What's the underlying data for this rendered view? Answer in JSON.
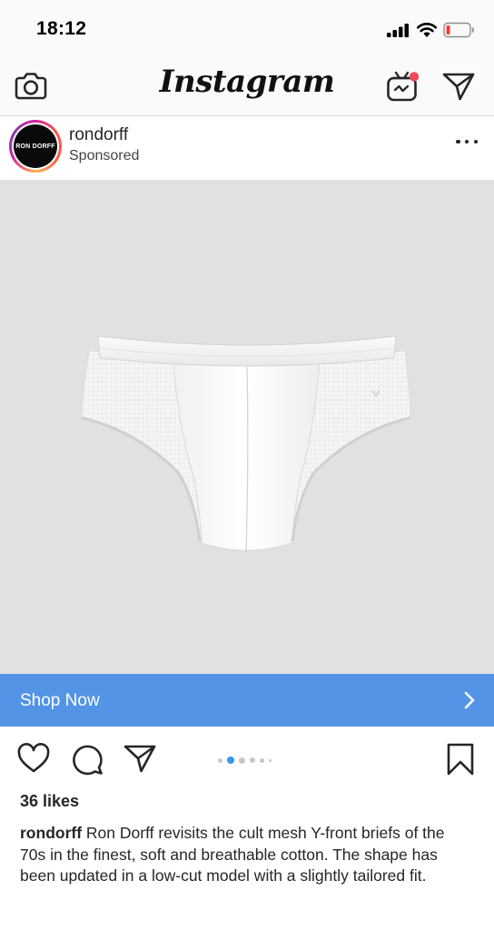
{
  "status_bar": {
    "time": "18:12",
    "icons": [
      "signal-icon",
      "wifi-icon",
      "battery-low-icon"
    ],
    "battery_color": "#ff3b30"
  },
  "nav": {
    "logo": "Instagram",
    "icons": [
      "camera-icon",
      "igtv-icon",
      "direct-message-icon"
    ],
    "notification_dot_color": "#ed4956"
  },
  "post": {
    "username": "rondorff",
    "subtitle": "Sponsored",
    "avatar_text": "RON DORFF",
    "more_icon": "more-options-icon",
    "image_icon": "mesh-briefs-product-image",
    "image_background": "#e1e1e1",
    "cta": {
      "label": "Shop Now",
      "icon": "chevron-right-icon",
      "color": "#5394e6"
    },
    "actions": {
      "icons": [
        "heart-icon",
        "comment-icon",
        "share-icon",
        "bookmark-icon"
      ]
    },
    "carousel": {
      "total_dots": 6,
      "active_index": 1,
      "active_color": "#3897f0"
    },
    "likes": "36 likes",
    "caption": {
      "username": "rondorff",
      "text": "Ron Dorff revisits the cult mesh Y-front briefs of the 70s in the finest, soft and breathable cotton. The shape has been updated in a low-cut model with a slightly tailored fit."
    }
  }
}
